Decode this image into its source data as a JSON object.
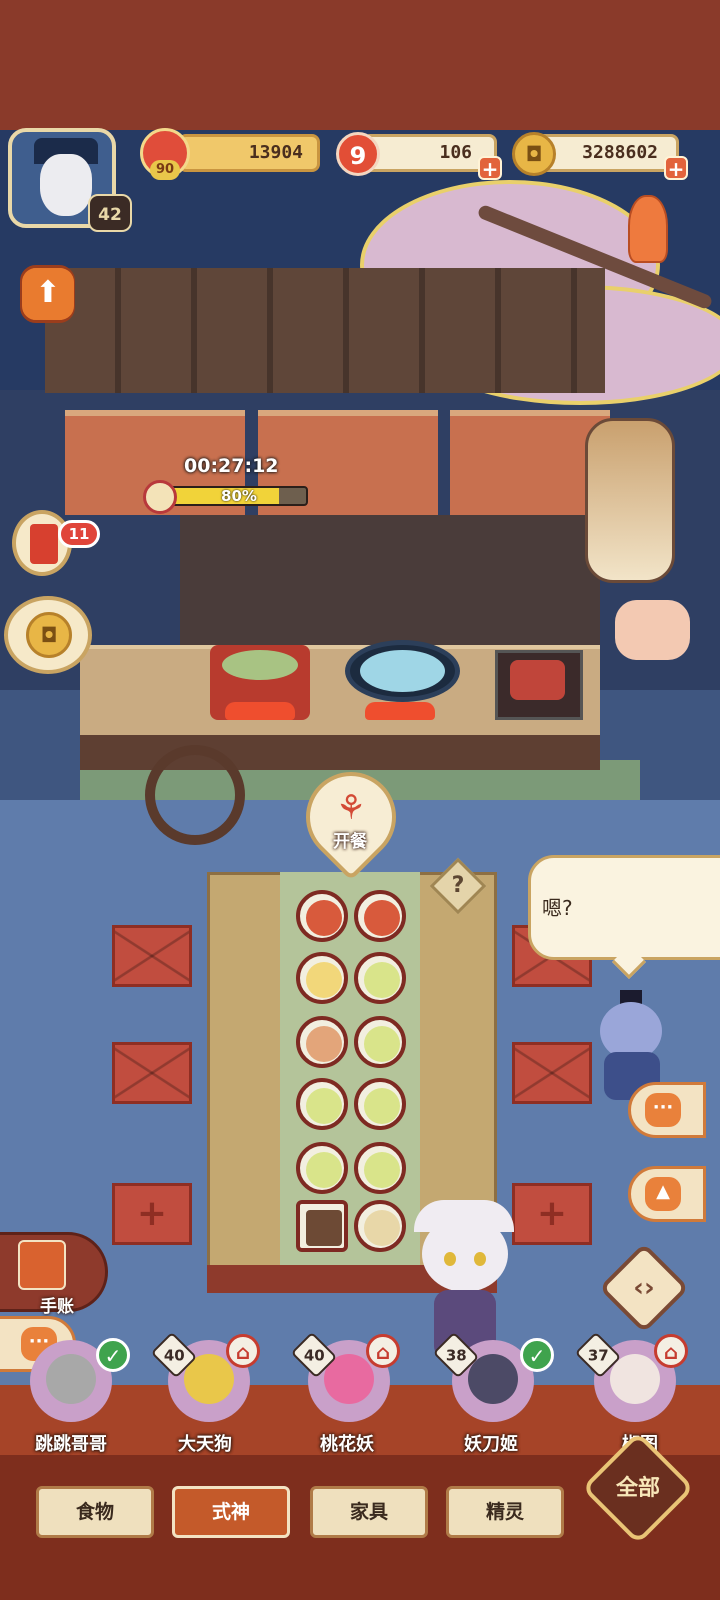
{
  "player": {
    "level": "42"
  },
  "resources": {
    "reputation": "13904",
    "reputation_badge": "90",
    "tickets": "106",
    "tickets_icon": "9",
    "coins": "3288602",
    "plus": "+"
  },
  "cooking": {
    "timer": "00:27:12",
    "progress_label": "80%",
    "progress": 0.8
  },
  "side": {
    "task_badge": "11"
  },
  "serve": {
    "label": "开餐",
    "icon": "spoon-fork-icon"
  },
  "help": {
    "label": "?"
  },
  "dialog": {
    "text": "嗯?"
  },
  "ledger": {
    "label": "手账"
  },
  "cushion_plus": "+",
  "characters": [
    {
      "name": "跳跳哥哥",
      "level": "",
      "status": "ok",
      "status_icon": "✓",
      "color": "#a8a8a8"
    },
    {
      "name": "大天狗",
      "level": "40",
      "status": "busy",
      "status_icon": "⌂",
      "color": "#e9c74a"
    },
    {
      "name": "桃花妖",
      "level": "40",
      "status": "busy",
      "status_icon": "⌂",
      "color": "#e86aa0"
    },
    {
      "name": "妖刀姬",
      "level": "38",
      "status": "ok",
      "status_icon": "✓",
      "color": "#4c4a66"
    },
    {
      "name": "椒图",
      "level": "37",
      "status": "busy",
      "status_icon": "⌂",
      "color": "#f0e4e0"
    }
  ],
  "tabs": [
    {
      "label": "食物",
      "active": false
    },
    {
      "label": "式神",
      "active": true
    },
    {
      "label": "家具",
      "active": false
    },
    {
      "label": "精灵",
      "active": false
    }
  ],
  "all_button": "全部",
  "colors": {
    "accent": "#c45a2a",
    "frame": "#c9a462",
    "progress": "#f1d339"
  }
}
